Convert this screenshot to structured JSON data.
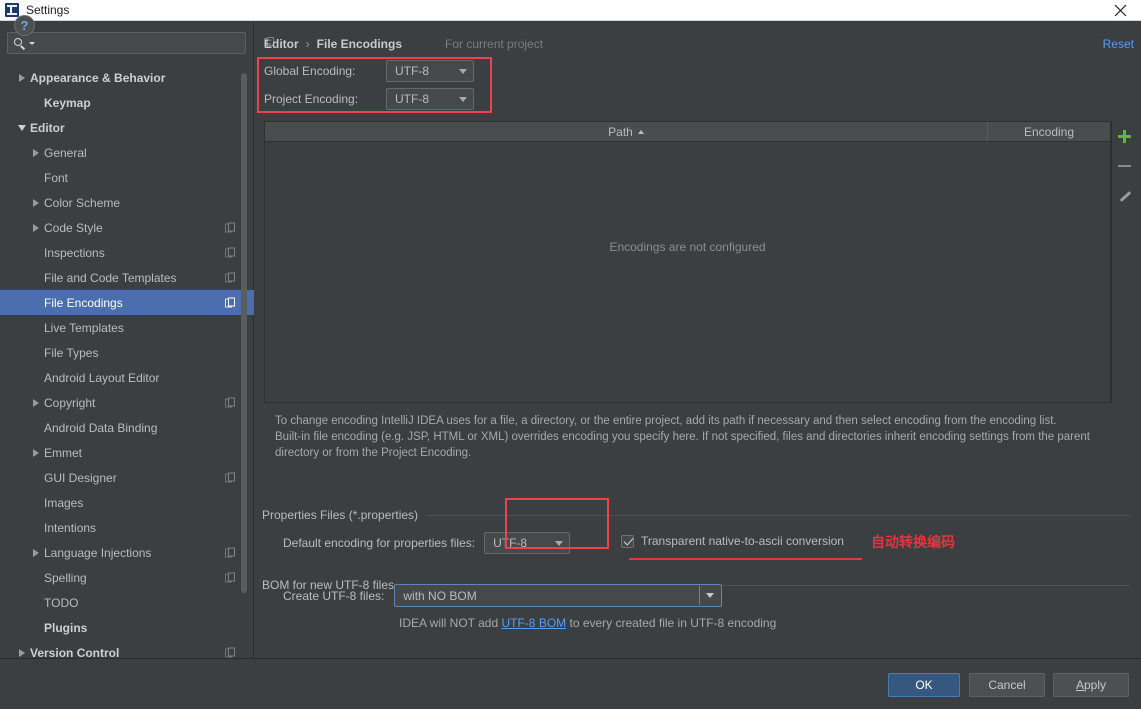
{
  "window": {
    "title": "Settings",
    "icon": "intellij-idea-icon",
    "close_label": "×"
  },
  "search": {
    "value": "",
    "placeholder": ""
  },
  "sidebar": {
    "items": [
      {
        "label": "Appearance & Behavior",
        "arrow": "collapsed",
        "indent": 1,
        "bold": true,
        "badge": false,
        "selected": false
      },
      {
        "label": "Keymap",
        "arrow": "none",
        "indent": 2,
        "bold": true,
        "badge": false,
        "selected": false
      },
      {
        "label": "Editor",
        "arrow": "expanded",
        "indent": 1,
        "bold": true,
        "badge": false,
        "selected": false
      },
      {
        "label": "General",
        "arrow": "collapsed",
        "indent": 2,
        "bold": false,
        "badge": false,
        "selected": false
      },
      {
        "label": "Font",
        "arrow": "none",
        "indent": 2,
        "bold": false,
        "badge": false,
        "selected": false
      },
      {
        "label": "Color Scheme",
        "arrow": "collapsed",
        "indent": 2,
        "bold": false,
        "badge": false,
        "selected": false
      },
      {
        "label": "Code Style",
        "arrow": "collapsed",
        "indent": 2,
        "bold": false,
        "badge": true,
        "selected": false
      },
      {
        "label": "Inspections",
        "arrow": "none",
        "indent": 2,
        "bold": false,
        "badge": true,
        "selected": false
      },
      {
        "label": "File and Code Templates",
        "arrow": "none",
        "indent": 2,
        "bold": false,
        "badge": true,
        "selected": false
      },
      {
        "label": "File Encodings",
        "arrow": "none",
        "indent": 2,
        "bold": false,
        "badge": true,
        "selected": true
      },
      {
        "label": "Live Templates",
        "arrow": "none",
        "indent": 2,
        "bold": false,
        "badge": false,
        "selected": false
      },
      {
        "label": "File Types",
        "arrow": "none",
        "indent": 2,
        "bold": false,
        "badge": false,
        "selected": false
      },
      {
        "label": "Android Layout Editor",
        "arrow": "none",
        "indent": 2,
        "bold": false,
        "badge": false,
        "selected": false
      },
      {
        "label": "Copyright",
        "arrow": "collapsed",
        "indent": 2,
        "bold": false,
        "badge": true,
        "selected": false
      },
      {
        "label": "Android Data Binding",
        "arrow": "none",
        "indent": 2,
        "bold": false,
        "badge": false,
        "selected": false
      },
      {
        "label": "Emmet",
        "arrow": "collapsed",
        "indent": 2,
        "bold": false,
        "badge": false,
        "selected": false
      },
      {
        "label": "GUI Designer",
        "arrow": "none",
        "indent": 2,
        "bold": false,
        "badge": true,
        "selected": false
      },
      {
        "label": "Images",
        "arrow": "none",
        "indent": 2,
        "bold": false,
        "badge": false,
        "selected": false
      },
      {
        "label": "Intentions",
        "arrow": "none",
        "indent": 2,
        "bold": false,
        "badge": false,
        "selected": false
      },
      {
        "label": "Language Injections",
        "arrow": "collapsed",
        "indent": 2,
        "bold": false,
        "badge": true,
        "selected": false
      },
      {
        "label": "Spelling",
        "arrow": "none",
        "indent": 2,
        "bold": false,
        "badge": true,
        "selected": false
      },
      {
        "label": "TODO",
        "arrow": "none",
        "indent": 2,
        "bold": false,
        "badge": false,
        "selected": false
      },
      {
        "label": "Plugins",
        "arrow": "none",
        "indent": 2,
        "bold": true,
        "badge": false,
        "selected": false
      },
      {
        "label": "Version Control",
        "arrow": "collapsed",
        "indent": 1,
        "bold": true,
        "badge": true,
        "selected": false
      }
    ]
  },
  "header": {
    "breadcrumb_parent": "Editor",
    "breadcrumb_separator": "›",
    "breadcrumb_current": "File Encodings",
    "context_label": "For current project",
    "reset_label": "Reset"
  },
  "encoding": {
    "global_label": "Global Encoding:",
    "global_value": "UTF-8",
    "project_label": "Project Encoding:",
    "project_value": "UTF-8"
  },
  "table": {
    "columns": [
      "Path",
      "Encoding"
    ],
    "sort_column": "Path",
    "sort_direction": "ascending",
    "rows": [],
    "empty_message": "Encodings are not configured",
    "tools": [
      "add-icon",
      "remove-icon",
      "edit-icon"
    ]
  },
  "description": {
    "line1": "To change encoding IntelliJ IDEA uses for a file, a directory, or the entire project, add its path if necessary and then select encoding from the encoding list.",
    "line2": "Built-in file encoding (e.g. JSP, HTML or XML) overrides encoding you specify here. If not specified, files and directories inherit encoding settings from the parent",
    "line3": "directory or from the Project Encoding."
  },
  "properties_section": {
    "group_title": "Properties Files (*.properties)",
    "default_encoding_label": "Default encoding for properties files:",
    "default_encoding_value": "UTF-8",
    "checkbox_label": "Transparent native-to-ascii conversion",
    "checkbox_checked": true,
    "annotation": "自动转换编码"
  },
  "bom_section": {
    "group_title": "BOM for new UTF-8 files",
    "create_label": "Create UTF-8 files:",
    "create_value": "with NO BOM",
    "note_prefix": "IDEA will NOT add ",
    "note_link": "UTF-8 BOM",
    "note_suffix": " to every created file in UTF-8 encoding"
  },
  "footer": {
    "help_label": "?",
    "ok_label": "OK",
    "cancel_label": "Cancel",
    "apply_label_underlined": "A",
    "apply_label_rest": "pply"
  },
  "colors": {
    "background": "#3c3f41",
    "selection": "#4b6eaf",
    "link": "#589df6",
    "accent_red": "#f0424b",
    "add_green": "#62b543",
    "ok_button": "#365880"
  }
}
